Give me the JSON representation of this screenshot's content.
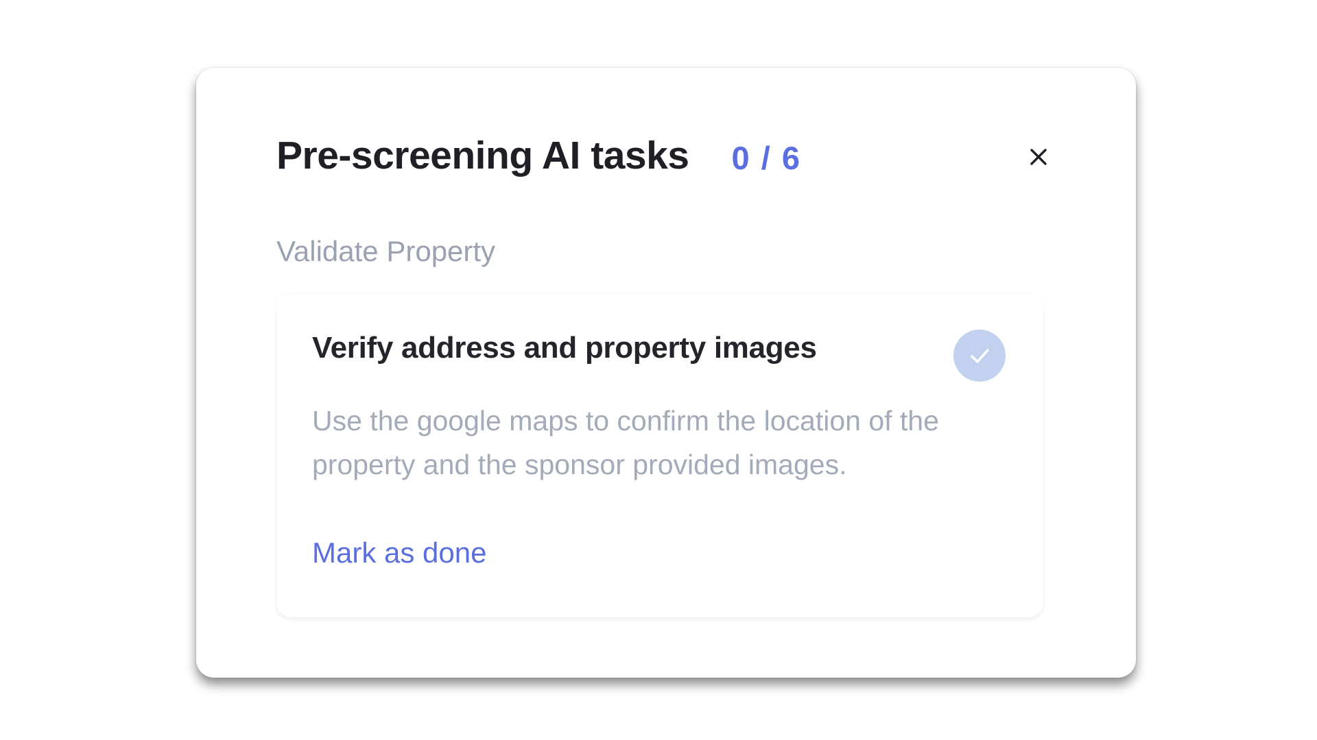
{
  "dialog": {
    "title": "Pre-screening AI tasks",
    "progress": {
      "display": "0 / 6",
      "completed": 0,
      "total": 6
    },
    "close_icon": "close-icon"
  },
  "section": {
    "label": "Validate Property"
  },
  "task": {
    "title": "Verify address and property images",
    "description": "Use the google maps to confirm the location of the property and the sponsor provided images.",
    "status_icon": "check-icon",
    "completed": false,
    "action_label": "Mark as done"
  },
  "colors": {
    "accent": "#5b6ee0",
    "check_circle": "#c2d1f0",
    "muted_text": "#a3aab8",
    "title_text": "#1f2025"
  }
}
